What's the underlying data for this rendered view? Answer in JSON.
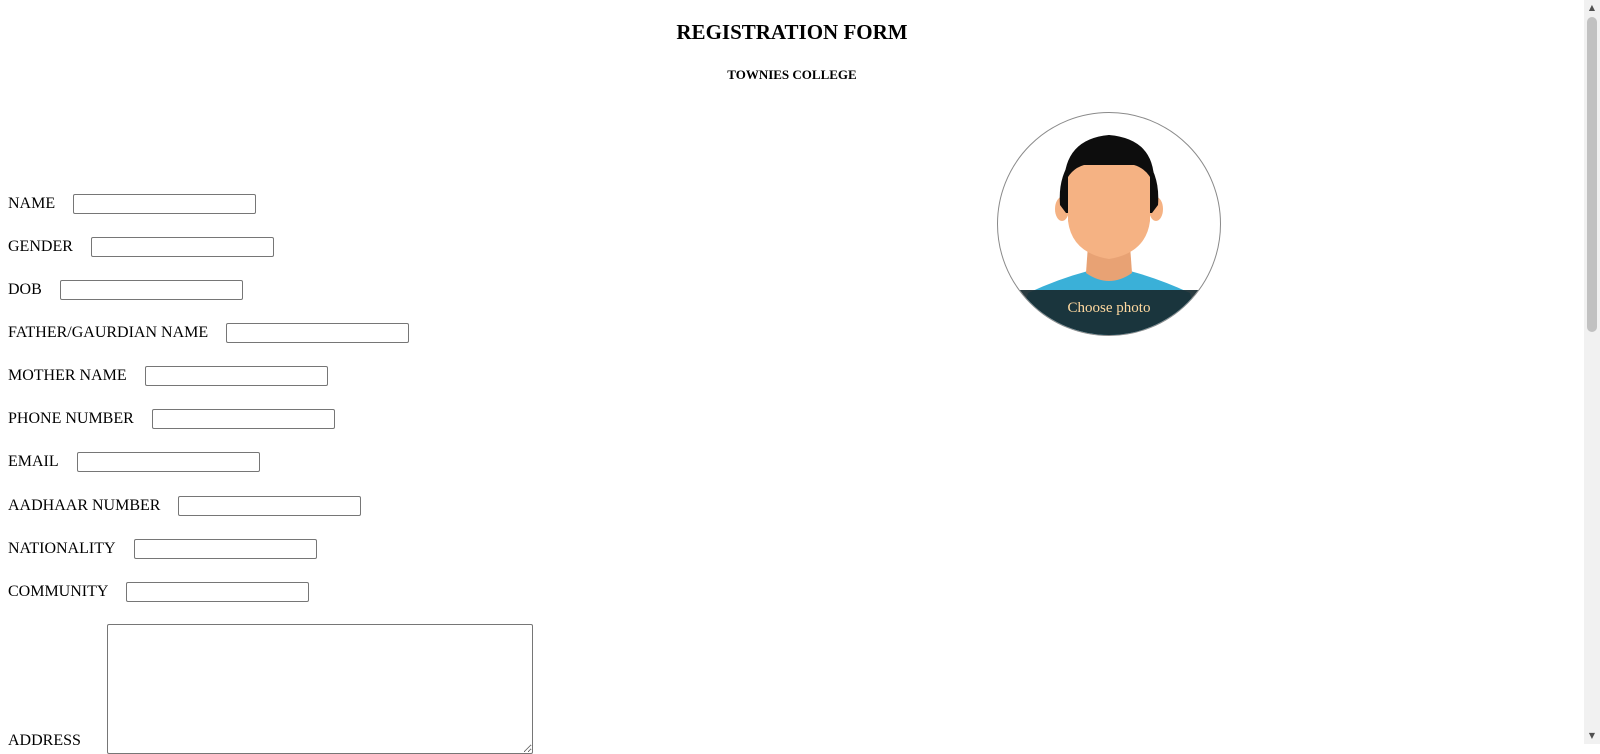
{
  "header": {
    "title": "REGISTRATION FORM",
    "college": "TOWNIES COLLEGE"
  },
  "fields": [
    {
      "label": "NAME",
      "value": ""
    },
    {
      "label": "GENDER",
      "value": ""
    },
    {
      "label": "DOB",
      "value": ""
    },
    {
      "label": "FATHER/GAURDIAN NAME",
      "value": ""
    },
    {
      "label": "MOTHER NAME",
      "value": ""
    },
    {
      "label": "PHONE NUMBER",
      "value": ""
    },
    {
      "label": "EMAIL",
      "value": ""
    },
    {
      "label": "AADHAAR NUMBER",
      "value": ""
    },
    {
      "label": "NATIONALITY",
      "value": ""
    },
    {
      "label": "COMMUNITY",
      "value": ""
    }
  ],
  "address": {
    "label": "ADDRESS",
    "value": ""
  },
  "photo": {
    "caption": "Choose photo",
    "icon": "avatar-placeholder-icon",
    "colors": {
      "skin": "#f5b283",
      "hair": "#0d0d0d",
      "shirt": "#3ab0d8",
      "overlay": "#18282e",
      "caption": "#ffd9a0"
    }
  },
  "scrollbar": {
    "up_icon": "▲",
    "down_icon": "▼"
  }
}
